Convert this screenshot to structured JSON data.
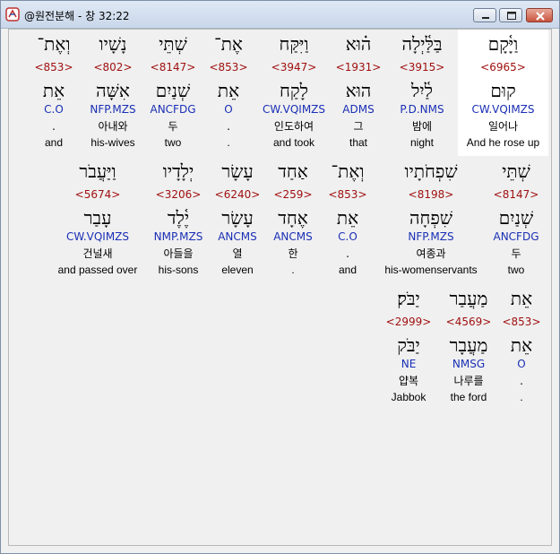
{
  "window": {
    "title": "@원전분해 - 창 32:22"
  },
  "rows": [
    [
      {
        "heb": "וַיָּ֫קָם",
        "num": "<6965>",
        "lemma": "קוּם",
        "parse": "CW.VQIMZS",
        "kor": "일어나",
        "eng": "And he rose up",
        "highlight": true
      },
      {
        "heb": "בַּלַּ֫יְלָה",
        "num": "<3915>",
        "lemma": "לַ֫יִל",
        "parse": "P.D.NMS",
        "kor": "밤에",
        "eng": "night"
      },
      {
        "heb": "ה֗וּא",
        "num": "<1931>",
        "lemma": "הוּא",
        "parse": "ADMS",
        "kor": "그",
        "eng": "that"
      },
      {
        "heb": "וַיִּקַּח",
        "num": "<3947>",
        "lemma": "לָקַח",
        "parse": "CW.VQIMZS",
        "kor": "인도하여",
        "eng": "and took"
      },
      {
        "heb": "אֶת־",
        "num": "<853>",
        "lemma": "אֵת",
        "parse": "O",
        "kor": ".",
        "eng": "."
      },
      {
        "heb": "שְׁתֵּי",
        "num": "<8147>",
        "lemma": "שְׁנַיִם",
        "parse": "ANCFDG",
        "kor": "두",
        "eng": "two"
      },
      {
        "heb": "נָשָׁיו",
        "num": "<802>",
        "lemma": "אִשָּׁה",
        "parse": "NFP.MZS",
        "kor": "아내와",
        "eng": "his-wives"
      },
      {
        "heb": "וְאֶת־",
        "num": "<853>",
        "lemma": "אֵת",
        "parse": "C.O",
        "kor": ".",
        "eng": "and"
      }
    ],
    [
      {
        "heb": "שְׁתֵּי",
        "num": "<8147>",
        "lemma": "שְׁנַיִם",
        "parse": "ANCFDG",
        "kor": "두",
        "eng": "two"
      },
      {
        "heb": "שִׁפְחֹתָיו",
        "num": "<8198>",
        "lemma": "שִׁפְחָה",
        "parse": "NFP.MZS",
        "kor": "여종과",
        "eng": "his-womenservants"
      },
      {
        "heb": "וְאֶת־",
        "num": "<853>",
        "lemma": "אֵת",
        "parse": "C.O",
        "kor": ".",
        "eng": "and"
      },
      {
        "heb": "אַחַד",
        "num": "<259>",
        "lemma": "אֶחָד",
        "parse": "ANCMS",
        "kor": "한",
        "eng": "."
      },
      {
        "heb": "עָשָׂר",
        "num": "<6240>",
        "lemma": "עָשָׂר",
        "parse": "ANCMS",
        "kor": "열",
        "eng": "eleven"
      },
      {
        "heb": "יְלָדָיו",
        "num": "<3206>",
        "lemma": "יֶ֫לֶד",
        "parse": "NMP.MZS",
        "kor": "아들을",
        "eng": "his-sons"
      },
      {
        "heb": "וַיַּעֲבֹר",
        "num": "<5674>",
        "lemma": "עָבַר",
        "parse": "CW.VQIMZS",
        "kor": "건널새",
        "eng": "and passed over"
      }
    ],
    [
      {
        "heb": "אֵת",
        "num": "<853>",
        "lemma": "אֵת",
        "parse": "O",
        "kor": ".",
        "eng": "."
      },
      {
        "heb": "מַעֲבַר",
        "num": "<4569>",
        "lemma": "מַעֲבָר",
        "parse": "NMSG",
        "kor": "나루를",
        "eng": "the ford"
      },
      {
        "heb": "יַבֹּק׃",
        "num": "<2999>",
        "lemma": "יַבֹּק",
        "parse": "NE",
        "kor": "얍복",
        "eng": "Jabbok"
      }
    ]
  ]
}
